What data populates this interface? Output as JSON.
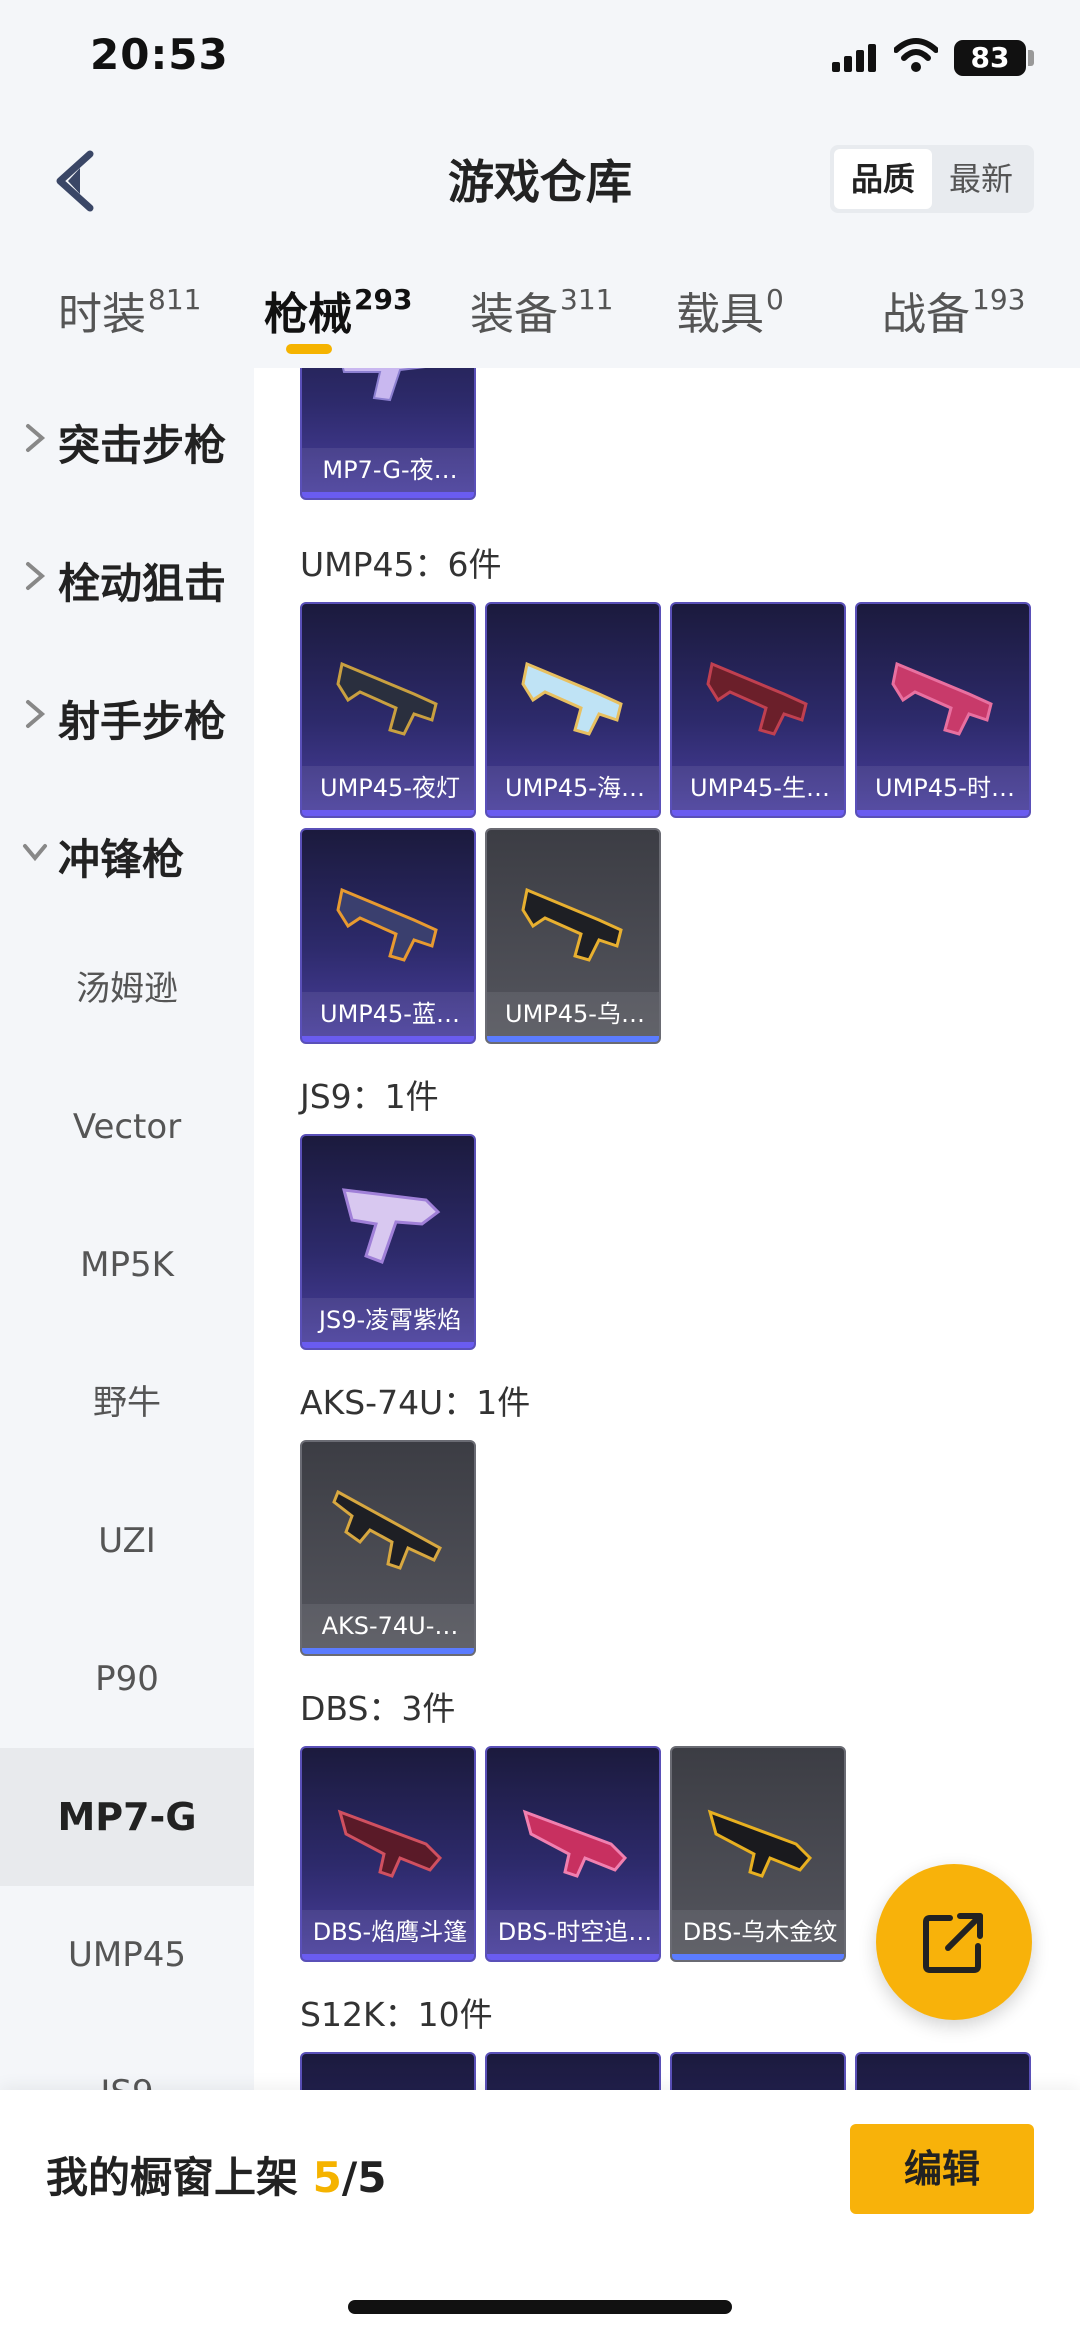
{
  "status": {
    "time": "20:53",
    "battery": "83"
  },
  "header": {
    "title": "游戏仓库",
    "sort_quality": "品质",
    "sort_newest": "最新"
  },
  "tabs": [
    {
      "label": "时装",
      "count": "811"
    },
    {
      "label": "枪械",
      "count": "293"
    },
    {
      "label": "装备",
      "count": "311"
    },
    {
      "label": "载具",
      "count": "0"
    },
    {
      "label": "战备",
      "count": "193"
    }
  ],
  "sidebar": {
    "categories": [
      "突击步枪",
      "栓动狙击",
      "射手步枪",
      "冲锋枪"
    ],
    "subitems": [
      "汤姆逊",
      "Vector",
      "MP5K",
      "野牛",
      "UZI",
      "P90",
      "MP7-G",
      "UMP45",
      "JS9"
    ]
  },
  "sections": [
    {
      "title": "UMP45：6件"
    },
    {
      "title": "JS9：1件"
    },
    {
      "title": "AKS-74U：1件"
    },
    {
      "title": "DBS：3件"
    },
    {
      "title": "S12K：10件"
    }
  ],
  "cards": [
    "MP7-G-夜…",
    "UMP45-夜灯",
    "UMP45-海…",
    "UMP45-生…",
    "UMP45-时…",
    "UMP45-蓝…",
    "UMP45-乌…",
    "JS9-凌霄紫焰",
    "AKS-74U-…",
    "DBS-焰鹰斗篷",
    "DBS-时空追…",
    "DBS-乌木金纹"
  ],
  "bottom": {
    "label": "我的橱窗上架 ",
    "count": "5",
    "total": "/5",
    "edit": "编辑"
  },
  "colors": {
    "accent": "#f8b20a",
    "purple_card": "#2d2a6b",
    "grey_card": "#55565e"
  }
}
